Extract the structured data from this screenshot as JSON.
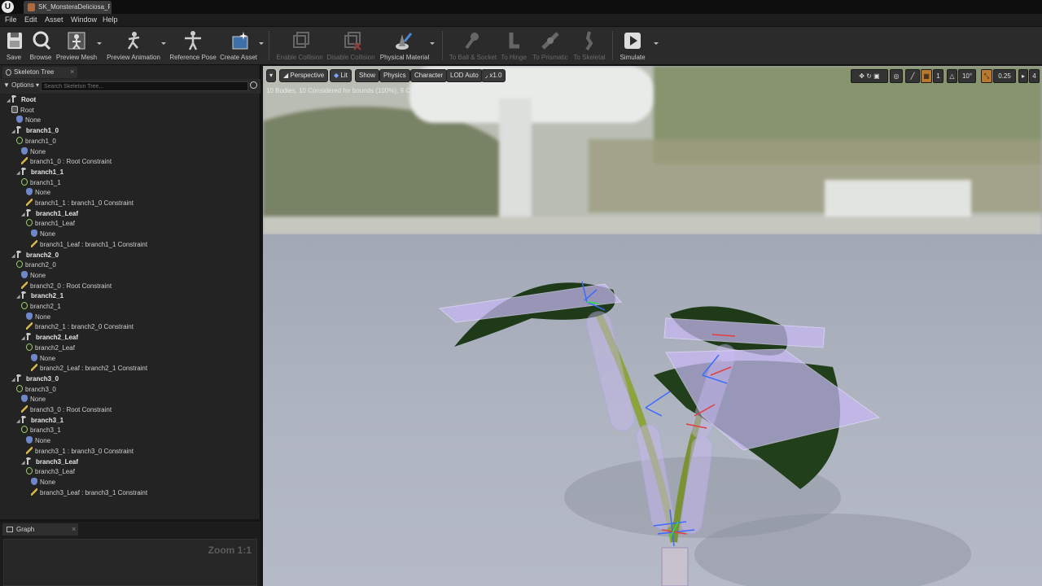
{
  "window": {
    "tab_title": "SK_MonsteraDeliciosa_Ph",
    "logo_letter": "U"
  },
  "menu": [
    "File",
    "Edit",
    "Asset",
    "Window",
    "Help"
  ],
  "toolbar": {
    "save": "Save",
    "browse": "Browse",
    "preview_mesh": "Preview Mesh",
    "preview_animation": "Preview Animation",
    "reference_pose": "Reference Pose",
    "create_asset": "Create Asset",
    "enable_collision": "Enable Collision",
    "disable_collision": "Disable Collision",
    "physical_material": "Physical Material",
    "to_ball_socket": "To Ball & Socket",
    "to_hinge": "To Hinge",
    "to_prismatic": "To Prismatic",
    "to_skeletal": "To Skeletal",
    "simulate": "Simulate"
  },
  "skeleton_tree": {
    "tab_label": "Skeleton Tree",
    "options_label": "Options",
    "search_placeholder": "Search Skeleton Tree...",
    "rows": [
      {
        "text": "Root",
        "icon": "bone-icon",
        "bold": true
      },
      {
        "text": "Root",
        "icon": "lock-icon",
        "bold": false
      },
      {
        "text": "None",
        "icon": "shape-icon",
        "bold": false
      },
      {
        "text": "branch1_0",
        "icon": "bone-icon",
        "bold": true
      },
      {
        "text": "branch1_0",
        "icon": "body-icon",
        "bold": false
      },
      {
        "text": "None",
        "icon": "shape-icon",
        "bold": false
      },
      {
        "text": "branch1_0 : Root Constraint",
        "icon": "constraint-icon",
        "bold": false
      },
      {
        "text": "branch1_1",
        "icon": "bone-icon",
        "bold": true
      },
      {
        "text": "branch1_1",
        "icon": "body-icon",
        "bold": false
      },
      {
        "text": "None",
        "icon": "shape-icon",
        "bold": false
      },
      {
        "text": "branch1_1 : branch1_0 Constraint",
        "icon": "constraint-icon",
        "bold": false
      },
      {
        "text": "branch1_Leaf",
        "icon": "bone-icon",
        "bold": true
      },
      {
        "text": "branch1_Leaf",
        "icon": "body-icon",
        "bold": false
      },
      {
        "text": "None",
        "icon": "shape-icon",
        "bold": false
      },
      {
        "text": "branch1_Leaf : branch1_1 Constraint",
        "icon": "constraint-icon",
        "bold": false
      },
      {
        "text": "branch2_0",
        "icon": "bone-icon",
        "bold": true
      },
      {
        "text": "branch2_0",
        "icon": "body-icon",
        "bold": false
      },
      {
        "text": "None",
        "icon": "shape-icon",
        "bold": false
      },
      {
        "text": "branch2_0 : Root Constraint",
        "icon": "constraint-icon",
        "bold": false
      },
      {
        "text": "branch2_1",
        "icon": "bone-icon",
        "bold": true
      },
      {
        "text": "branch2_1",
        "icon": "body-icon",
        "bold": false
      },
      {
        "text": "None",
        "icon": "shape-icon",
        "bold": false
      },
      {
        "text": "branch2_1 : branch2_0 Constraint",
        "icon": "constraint-icon",
        "bold": false
      },
      {
        "text": "branch2_Leaf",
        "icon": "bone-icon",
        "bold": true
      },
      {
        "text": "branch2_Leaf",
        "icon": "body-icon",
        "bold": false
      },
      {
        "text": "None",
        "icon": "shape-icon",
        "bold": false
      },
      {
        "text": "branch2_Leaf : branch2_1 Constraint",
        "icon": "constraint-icon",
        "bold": false
      },
      {
        "text": "branch3_0",
        "icon": "bone-icon",
        "bold": true
      },
      {
        "text": "branch3_0",
        "icon": "body-icon",
        "bold": false
      },
      {
        "text": "None",
        "icon": "shape-icon",
        "bold": false
      },
      {
        "text": "branch3_0 : Root Constraint",
        "icon": "constraint-icon",
        "bold": false
      },
      {
        "text": "branch3_1",
        "icon": "bone-icon",
        "bold": true
      },
      {
        "text": "branch3_1",
        "icon": "body-icon",
        "bold": false
      },
      {
        "text": "None",
        "icon": "shape-icon",
        "bold": false
      },
      {
        "text": "branch3_1 : branch3_0 Constraint",
        "icon": "constraint-icon",
        "bold": false
      },
      {
        "text": "branch3_Leaf",
        "icon": "bone-icon",
        "bold": true
      },
      {
        "text": "branch3_Leaf",
        "icon": "body-icon",
        "bold": false
      },
      {
        "text": "None",
        "icon": "shape-icon",
        "bold": false
      },
      {
        "text": "branch3_Leaf : branch3_1 Constraint",
        "icon": "constraint-icon",
        "bold": false
      }
    ]
  },
  "graph": {
    "tab_label": "Graph",
    "zoom": "Zoom 1:1"
  },
  "viewport": {
    "perspective": "Perspective",
    "lit": "Lit",
    "show": "Show",
    "physics": "Physics",
    "character": "Character",
    "lod": "LOD Auto",
    "speed": "x1.0",
    "stats": "10 Bodies, 10 Considered for bounds (100%), 9 Constraints",
    "grid_snap_value": "1",
    "rotation_snap": "10°",
    "scale_snap": "0.25",
    "camera_speed": "4"
  }
}
